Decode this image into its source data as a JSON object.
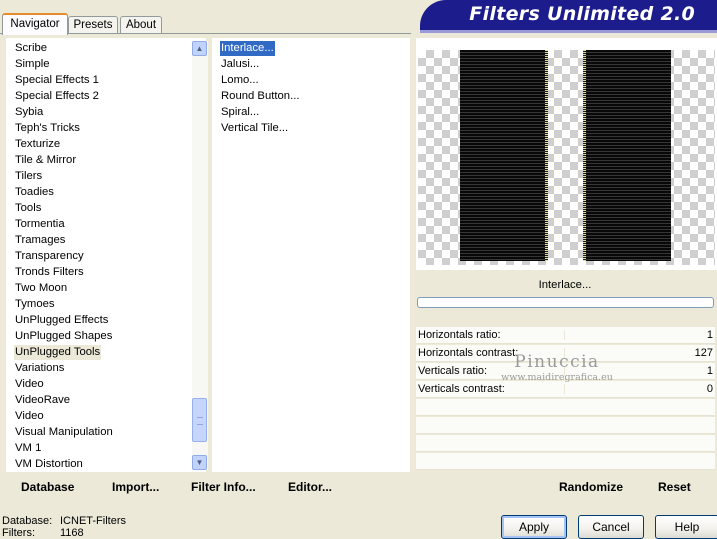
{
  "tabs": [
    "Navigator",
    "Presets",
    "About"
  ],
  "banner_title": "Filters Unlimited 2.0",
  "categories": [
    "Scribe",
    "Simple",
    "Special Effects 1",
    "Special Effects 2",
    "Sybia",
    "Teph's Tricks",
    "Texturize",
    "Tile & Mirror",
    "Tilers",
    "Toadies",
    "Tools",
    "Tormentia",
    "Tramages",
    "Transparency",
    "Tronds Filters",
    "Two Moon",
    "Tymoes",
    "UnPlugged Effects",
    "UnPlugged Shapes",
    "UnPlugged Tools",
    "Variations",
    "Video",
    "VideoRave",
    "Video",
    "Visual Manipulation",
    "VM 1",
    "VM Distortion"
  ],
  "selected_category": "UnPlugged Tools",
  "filters": [
    "Interlace...",
    "Jalusi...",
    "Lomo...",
    "Round Button...",
    "Spiral...",
    "Vertical Tile..."
  ],
  "selected_filter": "Interlace...",
  "scroll": {
    "up_glyph": "▲",
    "down_glyph": "▼"
  },
  "preview": {
    "filter_name": "Interlace..."
  },
  "parameters": [
    {
      "label": "Horizontals ratio:",
      "value": "1"
    },
    {
      "label": "Horizontals contrast:",
      "value": "127"
    },
    {
      "label": "Verticals ratio:",
      "value": "1"
    },
    {
      "label": "Verticals contrast:",
      "value": "0"
    }
  ],
  "watermark": {
    "name": "Pinuccia",
    "url": "www.maidiregrafica.eu"
  },
  "left_actions": [
    "Database",
    "Import...",
    "Filter Info...",
    "Editor..."
  ],
  "right_actions": [
    "Randomize",
    "Reset"
  ],
  "status": {
    "database_label": "Database:",
    "database_value": "ICNET-Filters",
    "filters_label": "Filters:",
    "filters_value": "1168"
  },
  "buttons": {
    "apply": "Apply",
    "cancel": "Cancel",
    "help": "Help"
  },
  "colors": {
    "banner": "#1c1c8c",
    "selection": "#316ac5",
    "dialog_bg": "#ece9d8"
  }
}
